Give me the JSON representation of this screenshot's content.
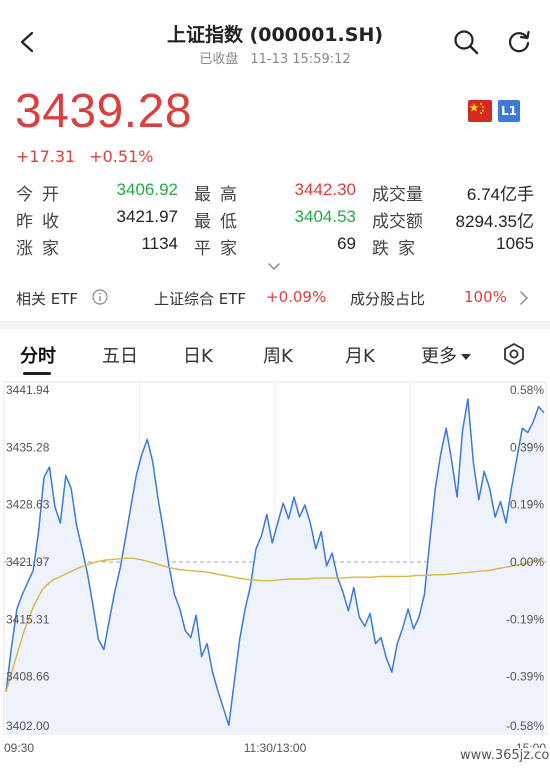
{
  "header": {
    "title": "上证指数 (000001.SH)",
    "status": "已收盘",
    "datetime": "11-13 15:59:12"
  },
  "quote": {
    "price": "3439.28",
    "change": "+17.31",
    "change_pct": "+0.51%",
    "badge": "L1"
  },
  "stats": {
    "open_label": "今开",
    "open": "3406.92",
    "high_label": "最高",
    "high": "3442.30",
    "volume_label": "成交量",
    "volume": "6.74亿手",
    "prev_close_label": "昨收",
    "prev_close": "3421.97",
    "low_label": "最低",
    "low": "3404.53",
    "amount_label": "成交额",
    "amount": "8294.35亿",
    "up_label": "涨家",
    "up": "1134",
    "flat_label": "平家",
    "flat": "69",
    "down_label": "跌家",
    "down": "1065"
  },
  "etf": {
    "label": "相关 ETF",
    "name": "上证综合 ETF",
    "change": "+0.09%",
    "ratio_label": "成分股占比",
    "ratio": "100%"
  },
  "tabs": [
    "分时",
    "五日",
    "日K",
    "周K",
    "月K",
    "更多"
  ],
  "chart_data": {
    "type": "line",
    "y_left_ticks": [
      "3441.94",
      "3435.28",
      "3428.63",
      "3421.97",
      "3415.31",
      "3408.66",
      "3402.00"
    ],
    "y_right_ticks": [
      "0.58%",
      "0.39%",
      "0.19%",
      "0.00%",
      "-0.19%",
      "-0.39%",
      "-0.58%"
    ],
    "x_ticks": [
      "09:30",
      "11:30/13:00",
      "15:00"
    ],
    "ylim": [
      3402.0,
      3441.94
    ],
    "reference": 3421.97,
    "series": [
      {
        "values": [
          3406.9,
          3412.0,
          3416.5,
          3418.2,
          3419.6,
          3421.0,
          3425.5,
          3431.8,
          3433.0,
          3428.4,
          3426.5,
          3432.0,
          3430.5,
          3426.2,
          3423.5,
          3420.6,
          3417.0,
          3413.0,
          3411.8,
          3415.2,
          3418.5,
          3421.2,
          3424.8,
          3428.5,
          3432.1,
          3434.5,
          3436.2,
          3433.6,
          3429.2,
          3425.5,
          3421.5,
          3418.2,
          3416.5,
          3414.0,
          3413.2,
          3415.8,
          3411.0,
          3412.5,
          3409.2,
          3407.0,
          3405.0,
          3403.0,
          3408.0,
          3413.0,
          3416.5,
          3419.2,
          3423.5,
          3425.0,
          3427.5,
          3424.2,
          3426.5,
          3428.8,
          3427.0,
          3429.5,
          3427.2,
          3428.6,
          3426.5,
          3423.5,
          3425.5,
          3421.5,
          3423.0,
          3420.2,
          3418.5,
          3416.3,
          3419.0,
          3415.6,
          3414.5,
          3416.0,
          3412.5,
          3413.2,
          3410.8,
          3409.2,
          3412.5,
          3414.3,
          3416.5,
          3414.2,
          3415.6,
          3418.2,
          3424.5,
          3430.5,
          3434.5,
          3437.5,
          3433.8,
          3429.5,
          3437.2,
          3440.9,
          3433.5,
          3429.2,
          3432.5,
          3430.5,
          3427.2,
          3429.0,
          3426.5,
          3430.5,
          3434.0,
          3437.5,
          3437.0,
          3438.2,
          3440.0,
          3439.3
        ]
      },
      {
        "values": [
          3406.9,
          3410.5,
          3414.0,
          3416.8,
          3418.8,
          3419.8,
          3420.3,
          3420.8,
          3421.3,
          3421.7,
          3422.0,
          3422.2,
          3422.3,
          3422.4,
          3422.4,
          3422.2,
          3421.9,
          3421.6,
          3421.3,
          3421.1,
          3421.0,
          3420.9,
          3420.8,
          3420.6,
          3420.4,
          3420.2,
          3420.0,
          3419.9,
          3419.8,
          3419.8,
          3419.9,
          3420.0,
          3420.0,
          3420.0,
          3420.1,
          3420.1,
          3420.1,
          3420.1,
          3420.2,
          3420.2,
          3420.2,
          3420.3,
          3420.3,
          3420.3,
          3420.3,
          3420.4,
          3420.4,
          3420.5,
          3420.5,
          3420.6,
          3420.7,
          3420.8,
          3420.9,
          3421.0,
          3421.2,
          3421.4,
          3421.6,
          3421.8,
          3422.1,
          3422.4
        ]
      }
    ]
  },
  "watermark": "www.365jz.com"
}
